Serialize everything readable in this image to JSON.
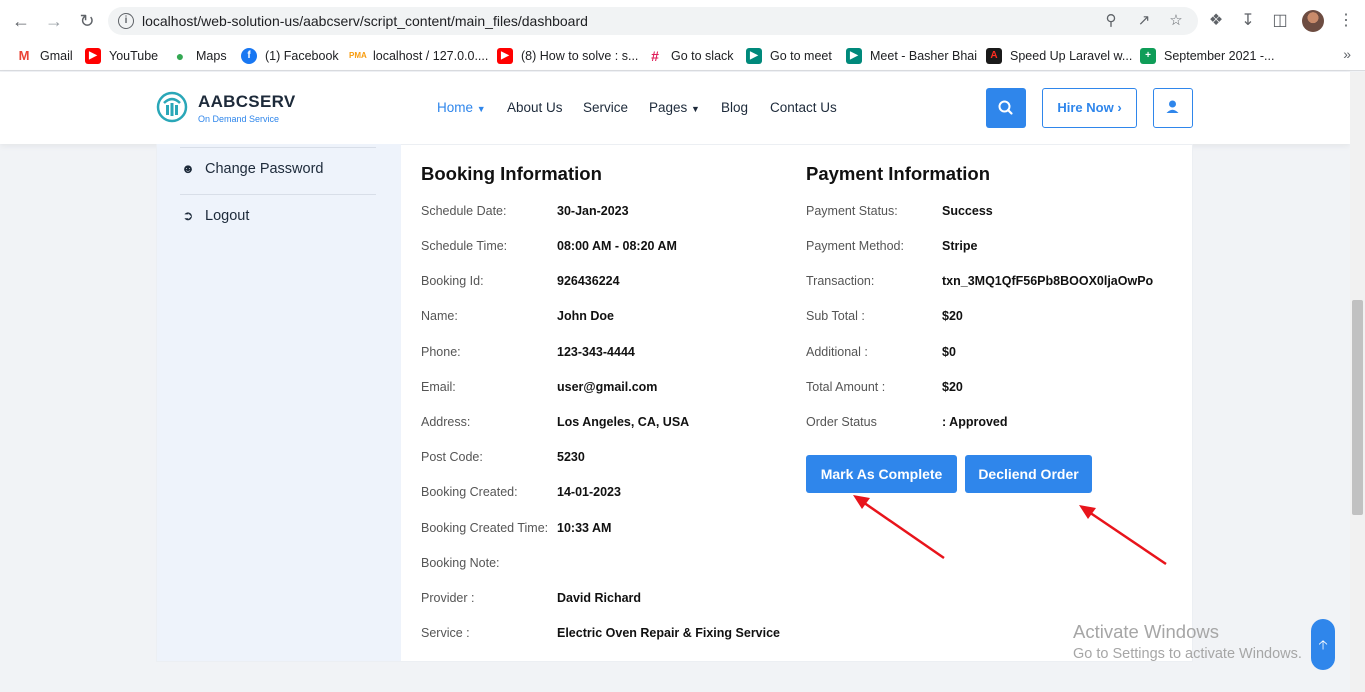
{
  "browser": {
    "url": "localhost/web-solution-us/aabcserv/script_content/main_files/dashboard",
    "bookmarks": [
      {
        "label": "Gmail",
        "icon": "gmail-icon",
        "color": "#ea4335"
      },
      {
        "label": "YouTube",
        "icon": "youtube-icon",
        "color": "#ff0000"
      },
      {
        "label": "Maps",
        "icon": "maps-icon",
        "color": "#34a853"
      },
      {
        "label": "(1) Facebook",
        "icon": "facebook-icon",
        "color": "#1877f2"
      },
      {
        "label": "localhost / 127.0.0....",
        "icon": "phpmyadmin-icon",
        "color": "#f89c0e"
      },
      {
        "label": "(8) How to solve : s...",
        "icon": "youtube-icon",
        "color": "#ff0000"
      },
      {
        "label": "Go to slack",
        "icon": "slack-icon",
        "color": "#4a154b"
      },
      {
        "label": "Go to meet",
        "icon": "meet-icon",
        "color": "#00897b"
      },
      {
        "label": "Meet - Basher Bhai",
        "icon": "meet-icon",
        "color": "#00897b"
      },
      {
        "label": "Speed Up Laravel w...",
        "icon": "laravel-icon",
        "color": "#1a1a1a"
      },
      {
        "label": "September 2021 -...",
        "icon": "sheets-icon",
        "color": "#0f9d58"
      }
    ]
  },
  "site": {
    "brand": "AABCSERV",
    "tagline": "On Demand Service",
    "accent": "#2f86eb",
    "menu": {
      "home": "Home",
      "about": "About Us",
      "service": "Service",
      "pages": "Pages",
      "blog": "Blog",
      "contact": "Contact Us"
    },
    "hire_now": "Hire Now"
  },
  "sidebar": {
    "change_password": "Change Password",
    "logout": "Logout"
  },
  "booking": {
    "title": "Booking Information",
    "rows": [
      {
        "label": "Schedule Date:",
        "value": "30-Jan-2023"
      },
      {
        "label": "Schedule Time:",
        "value": "08:00 AM - 08:20 AM"
      },
      {
        "label": "Booking Id:",
        "value": "926436224"
      },
      {
        "label": "Name:",
        "value": "John Doe"
      },
      {
        "label": "Phone:",
        "value": "123-343-4444"
      },
      {
        "label": "Email:",
        "value": "user@gmail.com"
      },
      {
        "label": "Address:",
        "value": "Los Angeles, CA, USA"
      },
      {
        "label": "Post Code:",
        "value": "5230"
      },
      {
        "label": "Booking Created:",
        "value": "14-01-2023"
      },
      {
        "label": "Booking Created Time:",
        "value": "10:33 AM"
      },
      {
        "label": "Booking Note:",
        "value": ""
      },
      {
        "label": "Provider :",
        "value": "David Richard"
      },
      {
        "label": "Service :",
        "value": "Electric Oven Repair & Fixing Service"
      }
    ]
  },
  "payment": {
    "title": "Payment Information",
    "rows": [
      {
        "label": "Payment Status:",
        "value": "Success"
      },
      {
        "label": "Payment Method:",
        "value": "Stripe"
      },
      {
        "label": "Transaction:",
        "value": "txn_3MQ1QfF56Pb8BOOX0ljaOwPo"
      },
      {
        "label": "Sub Total :",
        "value": "$20"
      },
      {
        "label": "Additional :",
        "value": "$0"
      },
      {
        "label": "Total Amount :",
        "value": "$20"
      },
      {
        "label": "Order Status",
        "value": ": Approved"
      }
    ]
  },
  "actions": {
    "mark_complete": "Mark As Complete",
    "decline": "Decliend Order"
  },
  "watermark": {
    "line1": "Activate Windows",
    "line2": "Go to Settings to activate Windows."
  }
}
